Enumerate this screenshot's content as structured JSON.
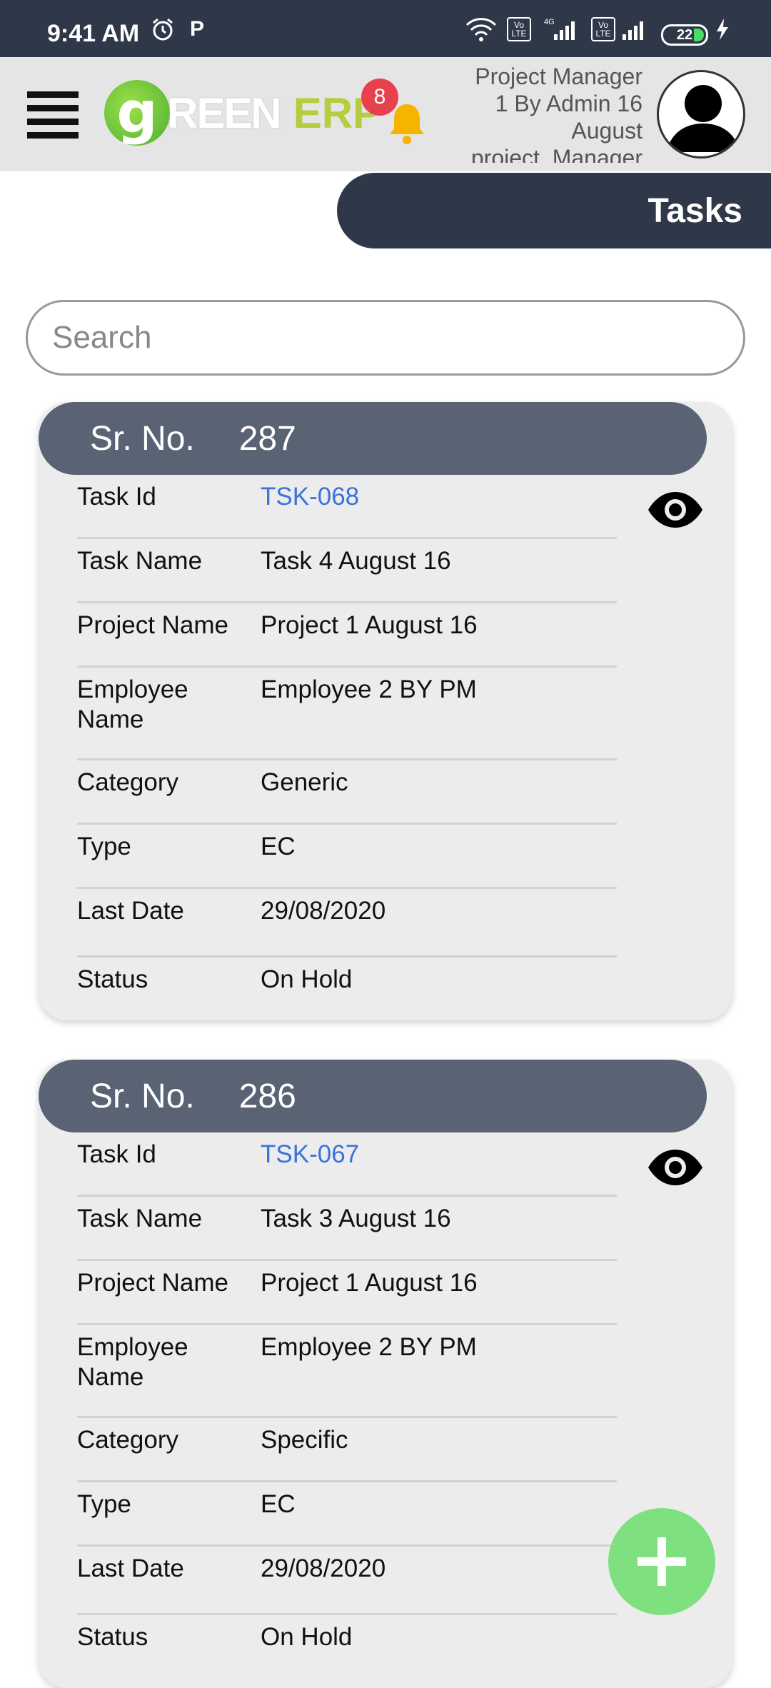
{
  "status_bar": {
    "time": "9:41 AM",
    "battery": "22",
    "icons": [
      "alarm-icon",
      "parking-icon",
      "wifi-icon",
      "volte-icon",
      "signal-icon",
      "volte-icon",
      "signal-icon",
      "charging-icon"
    ],
    "network_label": "4G",
    "volte_label": "Vo LTE"
  },
  "app_bar": {
    "logo_g": "g",
    "logo_reen": "REEN",
    "logo_erp": "ERP",
    "notification_count": "8",
    "user_line1": "Project Manager",
    "user_line2": "1 By Admin 16",
    "user_line3": "August",
    "user_line4": "project_Manager"
  },
  "page_title": "Tasks",
  "search": {
    "placeholder": "Search",
    "value": ""
  },
  "labels": {
    "srno": "Sr. No.",
    "task_id": "Task Id",
    "task_name": "Task Name",
    "project_name": "Project Name",
    "employee_name": "Employee Name",
    "category": "Category",
    "type": "Type",
    "last_date": "Last Date",
    "status": "Status"
  },
  "tasks": [
    {
      "srno": "287",
      "task_id": "TSK-068",
      "task_name": "Task 4 August 16",
      "project_name": "Project 1 August 16",
      "employee_name": "Employee 2 BY PM",
      "category": "Generic",
      "type": "EC",
      "last_date": "29/08/2020",
      "status": "On Hold"
    },
    {
      "srno": "286",
      "task_id": "TSK-067",
      "task_name": "Task 3 August 16",
      "project_name": "Project 1 August 16",
      "employee_name": "Employee 2 BY PM",
      "category": "Specific",
      "type": "EC",
      "last_date": "29/08/2020",
      "status": "On Hold"
    }
  ],
  "colors": {
    "header_dark": "#2e3848",
    "card_header": "#5a6374",
    "link": "#3a73d9",
    "fab": "#7ee07e",
    "badge": "#e8414e"
  }
}
